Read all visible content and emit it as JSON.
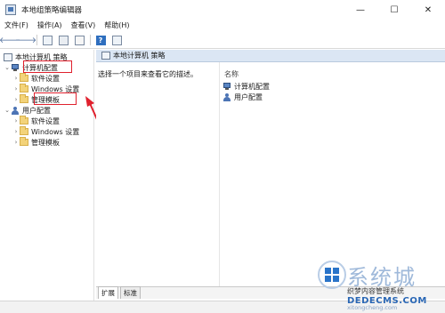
{
  "window": {
    "title": "本地组策略编辑器",
    "controls": [
      "—",
      "☐",
      "✕"
    ]
  },
  "menu": [
    "文件(F)",
    "操作(A)",
    "查看(V)",
    "帮助(H)"
  ],
  "toolbar": {
    "back": "🡐",
    "forward": "🡒",
    "help": "?"
  },
  "tree": {
    "root": "本地计算机 策略",
    "computer_config": "计算机配置",
    "computer_children": [
      "软件设置",
      "Windows 设置",
      "管理模板"
    ],
    "user_config": "用户配置",
    "user_children": [
      "软件设置",
      "Windows 设置",
      "管理模板"
    ]
  },
  "right_pane": {
    "header": "本地计算机 策略",
    "description": "选择一个项目来查看它的描述。",
    "column_name": "名称",
    "items": [
      "计算机配置",
      "用户配置"
    ]
  },
  "tabs": [
    "扩展",
    "标准"
  ],
  "watermark": {
    "big": "系统城",
    "small": "织梦内容管理系统",
    "site": "DEDECMS.COM",
    "site2": "xitongcheng.com"
  },
  "colors": {
    "highlight": "#e0212e",
    "header_bg": "#dbe6f4"
  }
}
